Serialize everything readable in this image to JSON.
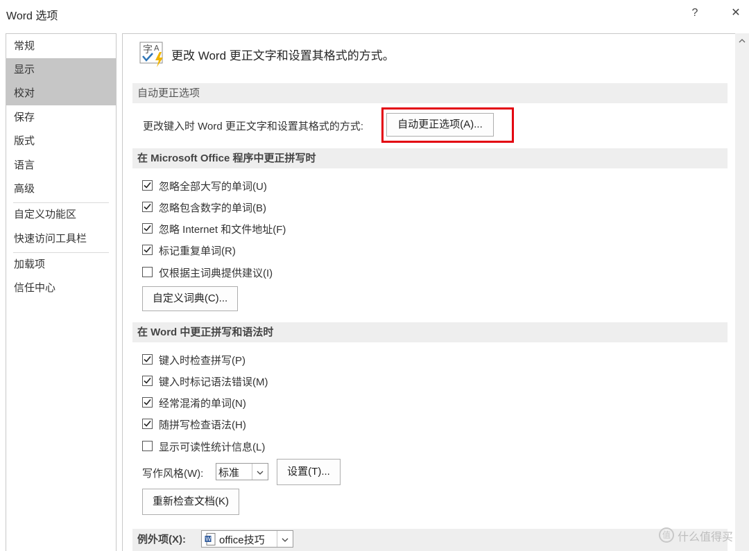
{
  "window": {
    "title": "Word 选项",
    "help_label": "?",
    "close_label": "✕"
  },
  "sidebar": {
    "items": [
      {
        "label": "常规",
        "active": false
      },
      {
        "label": "显示",
        "active": true
      },
      {
        "label": "校对",
        "active": true
      },
      {
        "label": "保存",
        "active": false
      },
      {
        "label": "版式",
        "active": false
      },
      {
        "label": "语言",
        "active": false
      },
      {
        "label": "高级",
        "active": false
      },
      {
        "label": "自定义功能区",
        "active": false
      },
      {
        "label": "快速访问工具栏",
        "active": false
      },
      {
        "label": "加载项",
        "active": false
      },
      {
        "label": "信任中心",
        "active": false
      }
    ]
  },
  "header": {
    "text": "更改 Word 更正文字和设置其格式的方式。",
    "icon": "proofing-icon"
  },
  "autocorrect": {
    "section_title": "自动更正选项",
    "description": "更改键入时 Word 更正文字和设置其格式的方式:",
    "button_label": "自动更正选项(A)...",
    "highlight_color": "#e3000f"
  },
  "office_spelling": {
    "section_title": "在 Microsoft Office 程序中更正拼写时",
    "options": [
      {
        "label": "忽略全部大写的单词(U)",
        "checked": true
      },
      {
        "label": "忽略包含数字的单词(B)",
        "checked": true
      },
      {
        "label": "忽略 Internet 和文件地址(F)",
        "checked": true
      },
      {
        "label": "标记重复单词(R)",
        "checked": true
      },
      {
        "label": "仅根据主词典提供建议(I)",
        "checked": false
      }
    ],
    "custom_dict_button": "自定义词典(C)..."
  },
  "word_spelling": {
    "section_title": "在 Word 中更正拼写和语法时",
    "options": [
      {
        "label": "键入时检查拼写(P)",
        "checked": true
      },
      {
        "label": "键入时标记语法错误(M)",
        "checked": true
      },
      {
        "label": "经常混淆的单词(N)",
        "checked": true
      },
      {
        "label": "随拼写检查语法(H)",
        "checked": true
      },
      {
        "label": "显示可读性统计信息(L)",
        "checked": false
      }
    ],
    "writing_style_label": "写作风格(W):",
    "writing_style_value": "标准",
    "settings_button": "设置(T)...",
    "recheck_button": "重新检查文档(K)"
  },
  "exceptions": {
    "label": "例外项(X):",
    "document_value": "office技巧"
  },
  "watermark": {
    "text": "什么值得买",
    "icon_glyph": "值"
  }
}
